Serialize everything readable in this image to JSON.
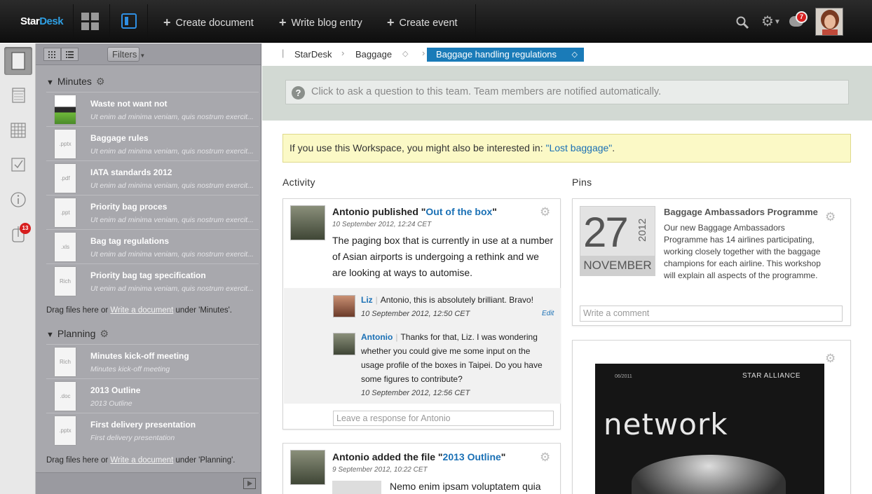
{
  "topbar": {
    "logo_star": "Star",
    "logo_desk": "Desk",
    "actions": [
      "Create document",
      "Write blog entry",
      "Create event"
    ],
    "notification_count": "7"
  },
  "iconstrip": {
    "items": [
      "documents-icon",
      "calendar-icon",
      "grid-icon",
      "checklist-icon",
      "info-icon",
      "attachments-icon"
    ],
    "badge": "13"
  },
  "docpanel": {
    "filters_label": "Filters",
    "sections": [
      {
        "title": "Minutes",
        "docs": [
          {
            "title": "Waste not want not",
            "sub": "Ut enim ad minima veniam, quis nostrum exercit...",
            "type": ""
          },
          {
            "title": "Baggage rules",
            "sub": "Ut enim ad minima veniam, quis nostrum exercit...",
            "type": ".pptx"
          },
          {
            "title": "IATA standards 2012",
            "sub": "Ut enim ad minima veniam, quis nostrum exercit...",
            "type": ".pdf"
          },
          {
            "title": "Priority bag proces",
            "sub": "Ut enim ad minima veniam, quis nostrum exercit...",
            "type": ".ppt"
          },
          {
            "title": "Bag tag regulations",
            "sub": "Ut enim ad minima veniam, quis nostrum exercit...",
            "type": ".xls"
          },
          {
            "title": "Priority bag tag specification",
            "sub": "Ut enim ad minima veniam, quis nostrum exercit...",
            "type": "Rich"
          }
        ],
        "drop_pre": "Drag files here or ",
        "drop_link": "Write a document",
        "drop_post": " under 'Minutes'."
      },
      {
        "title": "Planning",
        "docs": [
          {
            "title": "Minutes kick-off meeting",
            "sub": "Minutes kick-off meeting",
            "type": "Rich"
          },
          {
            "title": "2013 Outline",
            "sub": "2013 Outline",
            "type": ".doc"
          },
          {
            "title": "First delivery presentation",
            "sub": "First delivery presentation",
            "type": ".pptx"
          }
        ],
        "drop_pre": "Drag files here or ",
        "drop_link": "Write a document",
        "drop_post": " under 'Planning'."
      }
    ]
  },
  "breadcrumb": [
    "StarDesk",
    "Baggage",
    "Baggage handling regulations"
  ],
  "ask_placeholder": "Click to ask a question to this team. Team members are notified automatically.",
  "suggestion": {
    "pre": "If you use this Workspace, you might also be interested in: ",
    "link": "\"Lost baggage\"",
    "post": "."
  },
  "activity": {
    "heading": "Activity",
    "post1": {
      "author": "Antonio",
      "verb": " published \"",
      "link": "Out of the box",
      "close": "\"",
      "time": "10 September 2012, 12:24 CET",
      "body": "The paging box that is currently in use at a number of Asian airports is undergoing a rethink and we are looking at ways to automise.",
      "comments": [
        {
          "name": "Liz",
          "text": "Antonio, this is absolutely brilliant. Bravo!",
          "time": "10 September 2012, 12:50 CET",
          "edit": "Edit"
        },
        {
          "name": "Antonio",
          "text": "Thanks for that, Liz. I was wondering whether you could give me some input on the usage profile of the boxes in Taipei. Do you have some figures to contribute?",
          "time": "10 September 2012, 12:56 CET"
        }
      ],
      "respond_placeholder": "Leave a response for Antonio"
    },
    "post2": {
      "author": "Antonio",
      "verb": " added the file \"",
      "link": "2013 Outline",
      "close": "\"",
      "time": "9 September 2012, 10:22 CET",
      "body": "Nemo enim ipsam voluptatem quia"
    }
  },
  "pins": {
    "heading": "Pins",
    "event": {
      "day": "27",
      "year": "2012",
      "month": "NOVEMBER",
      "title": "Baggage Ambassadors Programme",
      "body": "Our new Baggage Ambassadors Programme has 14 airlines participating, working closely together with the baggage champions for each airline. This workshop will explain all aspects of the programme.",
      "comment_placeholder": "Write a comment"
    },
    "magazine": {
      "date": "06/2011",
      "brand": "STAR ALLIANCE",
      "title": "network"
    }
  },
  "colors": {
    "accent": "#1a7bb8",
    "link": "#1a70b5",
    "badge": "#d71f1f",
    "panel": "#a8a8ad"
  }
}
